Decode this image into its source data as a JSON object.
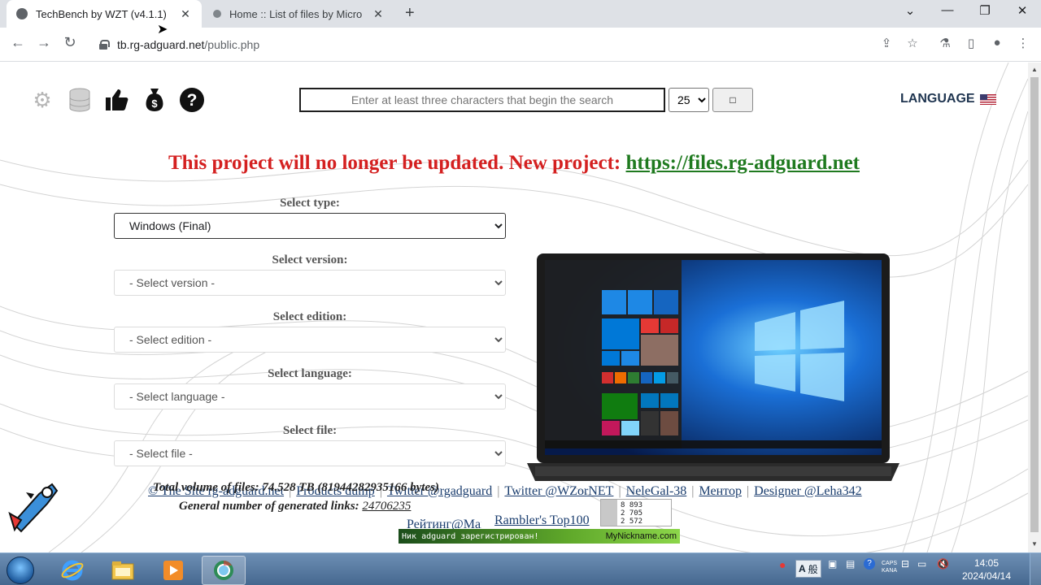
{
  "browser": {
    "tabs": [
      {
        "title": "TechBench by WZT (v4.1.1)",
        "active": true
      },
      {
        "title": "Home :: List of files by Micro",
        "active": false
      }
    ],
    "url_host": "tb.rg-adguard.net",
    "url_path": "/public.php"
  },
  "header": {
    "icons": [
      "gear-icon",
      "database-icon",
      "thumbs-up-icon",
      "money-bag-icon",
      "question-icon"
    ],
    "search_placeholder": "Enter at least three characters that begin the search",
    "per_page": "25",
    "search_button": "□",
    "language": "LANGUAGE"
  },
  "notice": {
    "text": "This project will no longer be updated. New project:",
    "link": "https://files.rg-adguard.net"
  },
  "form": {
    "type_label": "Select type:",
    "type_value": "Windows (Final)",
    "version_label": "Select version:",
    "version_value": "- Select version -",
    "edition_label": "Select edition:",
    "edition_value": "- Select edition -",
    "language_label": "Select language:",
    "language_value": "- Select language -",
    "file_label": "Select file:",
    "file_value": "- Select file -"
  },
  "footer": {
    "total_volume": "Total volume of files: 74.528 TB (81944282935166 bytes)",
    "generated_links_label": "General number of generated links:",
    "generated_links_value": "24706235",
    "links": [
      "© The Site rg-adguard.net",
      "Products dump",
      "Twitter @rgadguard",
      "Twitter @WZorNET",
      "NeleGal-38",
      "Ментор",
      "Designer @Leha342"
    ],
    "broken_img_1": "Рейтинг@Mail.ru",
    "broken_img_2": "Rambler's Top100",
    "counter": [
      "8 893",
      "2 705",
      "2 572"
    ],
    "nick_banner_text": "Ник adguard зарегистрирован!",
    "nick_banner_site": "MyNickname.com"
  },
  "taskbar": {
    "time": "14:05",
    "date": "2024/04/14",
    "ime_a": "A",
    "ime_kanji": "般",
    "caps": "CAPS",
    "kana": "KANA"
  },
  "colors": {
    "notice_red": "#d42020",
    "notice_link_green": "#1f7a1f",
    "language_navy": "#1f3550",
    "taskbar_blue": "#45688f"
  }
}
